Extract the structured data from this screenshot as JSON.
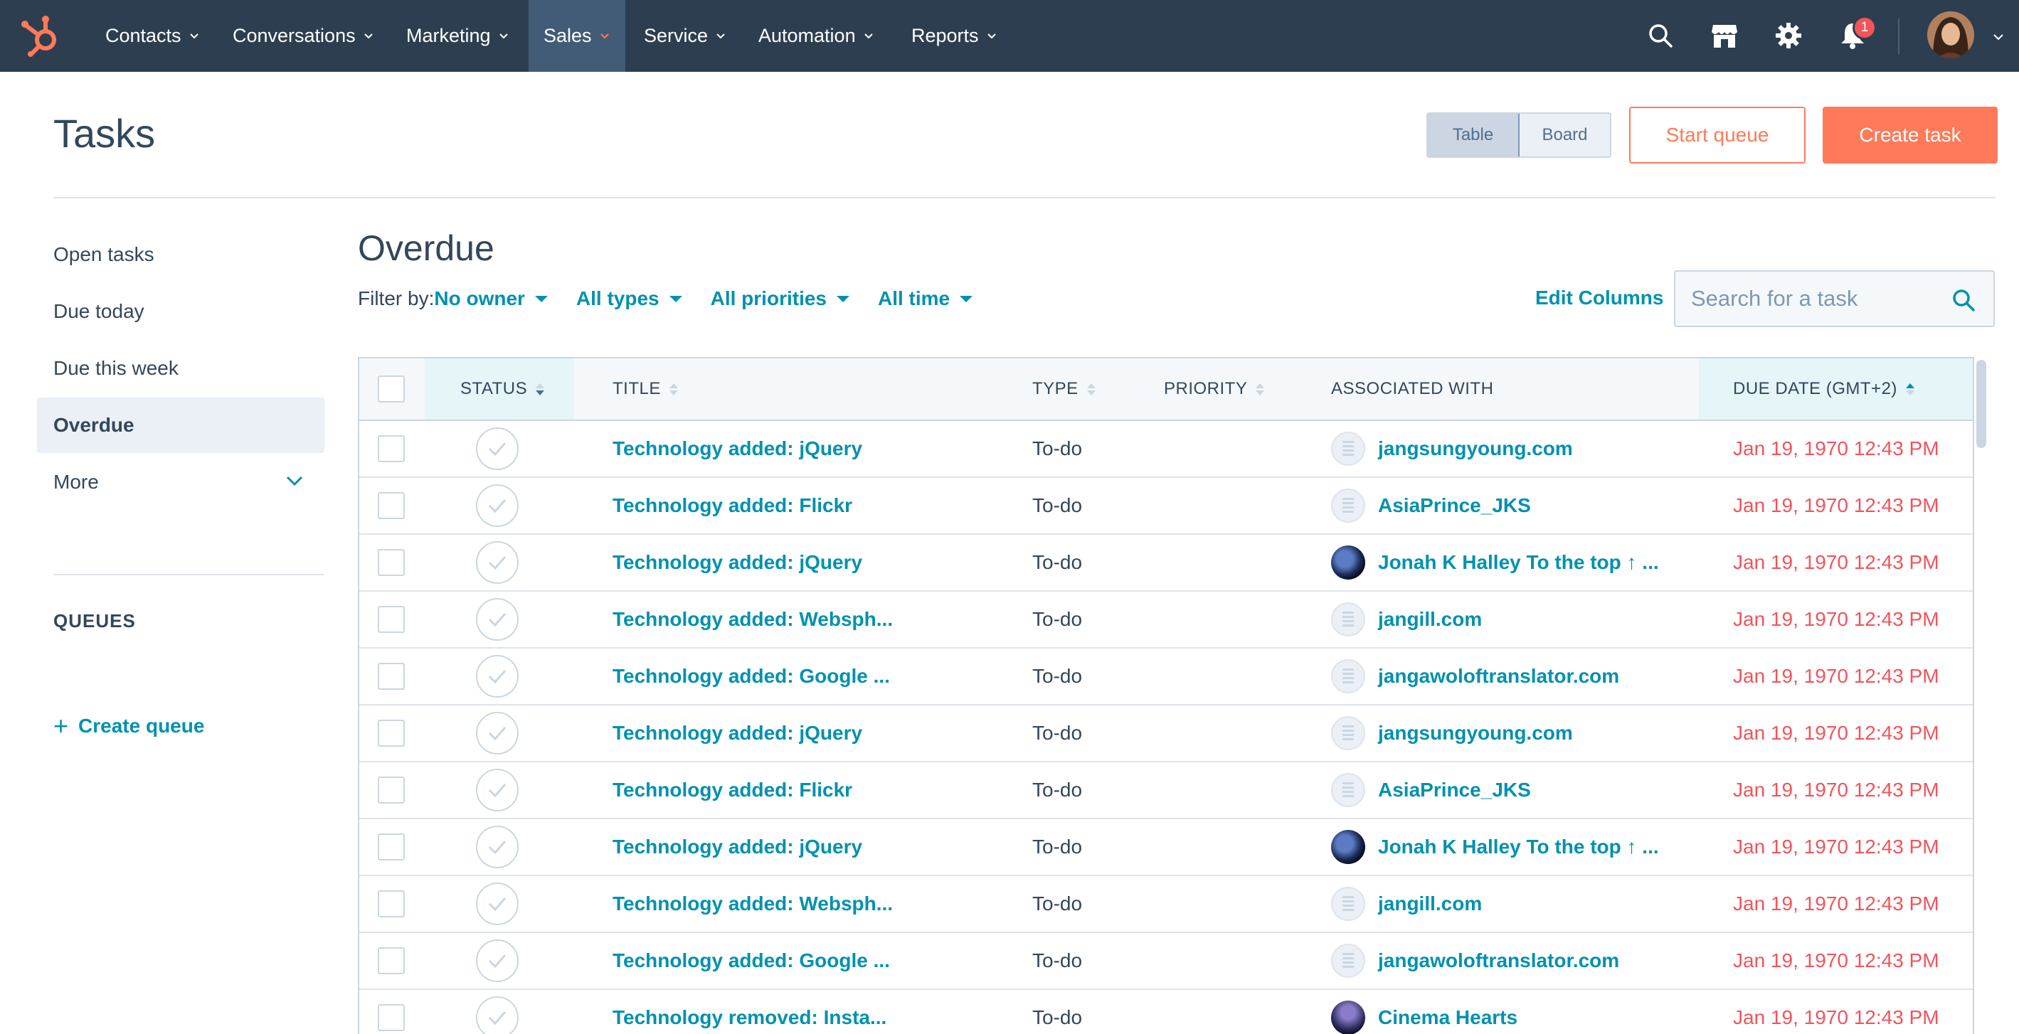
{
  "nav": {
    "items": [
      {
        "label": "Contacts"
      },
      {
        "label": "Conversations"
      },
      {
        "label": "Marketing"
      },
      {
        "label": "Sales"
      },
      {
        "label": "Service"
      },
      {
        "label": "Automation"
      },
      {
        "label": "Reports"
      }
    ],
    "active_item": "Sales",
    "notification_count": "1",
    "icons": [
      "search-icon",
      "marketplace-icon",
      "settings-icon",
      "notifications-icon"
    ]
  },
  "page": {
    "title": "Tasks",
    "view_toggle": {
      "table_label": "Table",
      "board_label": "Board",
      "selected": "Table"
    },
    "start_queue_label": "Start queue",
    "create_task_label": "Create task"
  },
  "sidebar": {
    "items": [
      {
        "label": "Open tasks"
      },
      {
        "label": "Due today"
      },
      {
        "label": "Due this week"
      },
      {
        "label": "Overdue"
      },
      {
        "label": "More"
      }
    ],
    "active_item": "Overdue",
    "queues_heading": "QUEUES",
    "create_queue_label": "Create queue"
  },
  "main": {
    "section_title": "Overdue",
    "filter_label": "Filter by:",
    "filters": {
      "owner": "No owner",
      "types": "All types",
      "priorities": "All priorities",
      "time": "All time"
    },
    "edit_columns_label": "Edit Columns",
    "search_placeholder": "Search for a task"
  },
  "table": {
    "columns": {
      "status": "STATUS",
      "title": "TITLE",
      "type": "TYPE",
      "priority": "PRIORITY",
      "associated": "ASSOCIATED WITH",
      "due": "DUE DATE (GMT+2)"
    },
    "rows": [
      {
        "title": "Technology added: jQuery",
        "type": "To-do",
        "priority": "",
        "associated": "jangsungyoung.com",
        "assoc_kind": "company",
        "due": "Jan 19, 1970 12:43 PM"
      },
      {
        "title": "Technology added: Flickr",
        "type": "To-do",
        "priority": "",
        "associated": "AsiaPrince_JKS",
        "assoc_kind": "company",
        "due": "Jan 19, 1970 12:43 PM"
      },
      {
        "title": "Technology added: jQuery",
        "type": "To-do",
        "priority": "",
        "associated": "Jonah K Halley To the top ↑ ...",
        "assoc_kind": "photo",
        "due": "Jan 19, 1970 12:43 PM"
      },
      {
        "title": "Technology added: Websph...",
        "type": "To-do",
        "priority": "",
        "associated": "jangill.com",
        "assoc_kind": "company",
        "due": "Jan 19, 1970 12:43 PM"
      },
      {
        "title": "Technology added: Google ...",
        "type": "To-do",
        "priority": "",
        "associated": "jangawoloftranslator.com",
        "assoc_kind": "company",
        "due": "Jan 19, 1970 12:43 PM"
      },
      {
        "title": "Technology added: jQuery",
        "type": "To-do",
        "priority": "",
        "associated": "jangsungyoung.com",
        "assoc_kind": "company",
        "due": "Jan 19, 1970 12:43 PM"
      },
      {
        "title": "Technology added: Flickr",
        "type": "To-do",
        "priority": "",
        "associated": "AsiaPrince_JKS",
        "assoc_kind": "company",
        "due": "Jan 19, 1970 12:43 PM"
      },
      {
        "title": "Technology added: jQuery",
        "type": "To-do",
        "priority": "",
        "associated": "Jonah K Halley To the top ↑ ...",
        "assoc_kind": "photo",
        "due": "Jan 19, 1970 12:43 PM"
      },
      {
        "title": "Technology added: Websph...",
        "type": "To-do",
        "priority": "",
        "associated": "jangill.com",
        "assoc_kind": "company",
        "due": "Jan 19, 1970 12:43 PM"
      },
      {
        "title": "Technology added: Google ...",
        "type": "To-do",
        "priority": "",
        "associated": "jangawoloftranslator.com",
        "assoc_kind": "company",
        "due": "Jan 19, 1970 12:43 PM"
      },
      {
        "title": "Technology removed: Insta...",
        "type": "To-do",
        "priority": "",
        "associated": "Cinema Hearts",
        "assoc_kind": "photo2",
        "due": "Jan 19, 1970 12:43 PM"
      }
    ]
  },
  "colors": {
    "nav_bg": "#2d3e50",
    "accent_orange": "#ff7a59",
    "link_teal": "#0091ae",
    "overdue_red": "#f2545b",
    "text_dark": "#33475b"
  }
}
